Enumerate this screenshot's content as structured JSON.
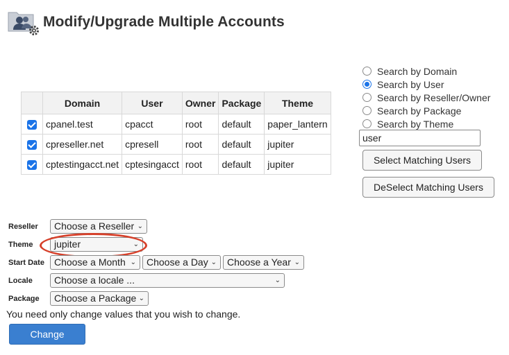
{
  "page": {
    "title": "Modify/Upgrade Multiple Accounts",
    "icon": "users-gear-icon"
  },
  "search": {
    "options": [
      {
        "label": "Search by Domain",
        "checked": false
      },
      {
        "label": "Search by User",
        "checked": true
      },
      {
        "label": "Search by Reseller/Owner",
        "checked": false
      },
      {
        "label": "Search by Package",
        "checked": false
      },
      {
        "label": "Search by Theme",
        "checked": false
      }
    ],
    "input_value": "user",
    "select_label": "Select Matching Users",
    "deselect_label": "DeSelect Matching Users"
  },
  "table": {
    "headers": [
      "Domain",
      "User",
      "Owner",
      "Package",
      "Theme"
    ],
    "rows": [
      {
        "checked": true,
        "domain": "cpanel.test",
        "user": "cpacct",
        "owner": "root",
        "package": "default",
        "theme": "paper_lantern"
      },
      {
        "checked": true,
        "domain": "cpreseller.net",
        "user": "cpresell",
        "owner": "root",
        "package": "default",
        "theme": "jupiter"
      },
      {
        "checked": true,
        "domain": "cptestingacct.net",
        "user": "cptesingacct",
        "owner": "root",
        "package": "default",
        "theme": "jupiter"
      }
    ]
  },
  "form": {
    "reseller_label": "Reseller",
    "reseller_value": "Choose a Reseller",
    "theme_label": "Theme",
    "theme_value": "jupiter",
    "start_date_label": "Start Date",
    "month_value": "Choose a Month",
    "day_value": "Choose a Day",
    "year_value": "Choose a Year",
    "locale_label": "Locale",
    "locale_value": "Choose a locale ...",
    "package_label": "Package",
    "package_value": "Choose a Package",
    "note": "You need only change values that you wish to change.",
    "change_label": "Change"
  },
  "colors": {
    "accent": "#1a73e8",
    "change_button": "#3a7fd0",
    "highlight": "#d6402a"
  }
}
